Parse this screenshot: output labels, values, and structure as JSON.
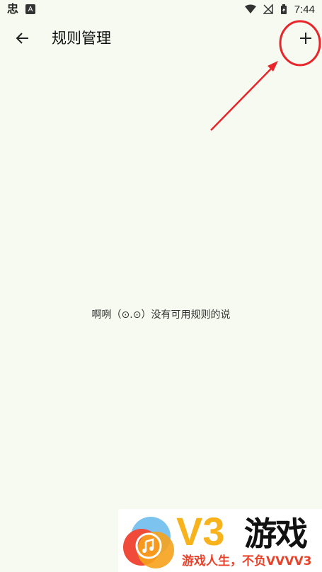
{
  "status_bar": {
    "app_icon": "忠",
    "notification_icon": "A",
    "time": "7:44"
  },
  "toolbar": {
    "title": "规则管理",
    "back_icon": "arrow-left-icon",
    "add_icon": "plus-icon"
  },
  "empty_state": {
    "message": "啊咧（⊙.⊙）没有可用规则的说"
  },
  "colors": {
    "background": "#f7faf0",
    "annotation": "#e8252a",
    "watermark_yellow": "#f7b21c",
    "watermark_red": "#e8432a"
  },
  "watermark": {
    "title": "V3",
    "name": "游戏",
    "slogan": "游戏人生，不负VVVV3"
  }
}
